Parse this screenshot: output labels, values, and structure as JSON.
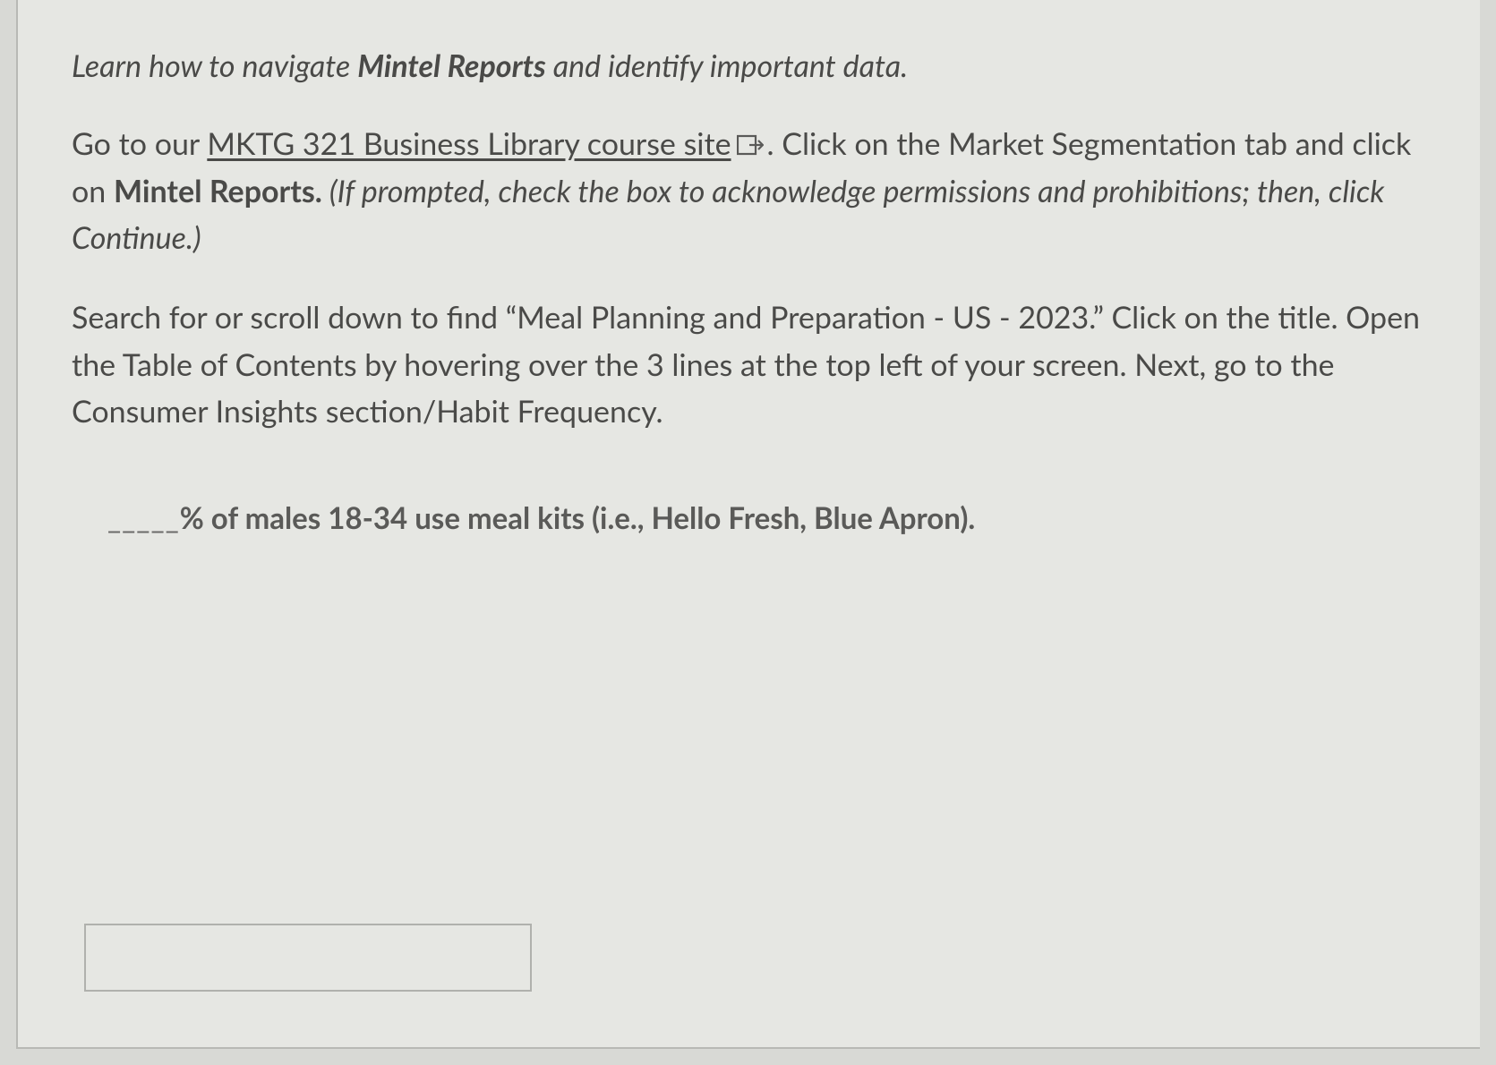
{
  "intro": {
    "prefix": "Learn how to navigate ",
    "bold": "Mintel Reports",
    "suffix": " and identify important data."
  },
  "para1": {
    "before_link": "Go to our ",
    "link_text": "MKTG 321 Business Library course site",
    "after_link_1": ". Click on the Market Segmentation tab and click on ",
    "bold": "Mintel Reports.",
    "italic": " (If prompted, check the box to acknowledge permissions and prohibitions; then, click Continue.)"
  },
  "para2": "Search for or scroll down to find “Meal Planning and Preparation - US - 2023.” Click on the title. Open the Table of Contents by hovering over the 3 lines at the top left of your screen. Next, go to the Consumer Insights section/Habit Frequency.",
  "question": {
    "blank": "_____",
    "text": "% of males 18-34 use meal kits (i.e., Hello Fresh, Blue Apron)."
  },
  "input": {
    "value": "",
    "placeholder": ""
  }
}
